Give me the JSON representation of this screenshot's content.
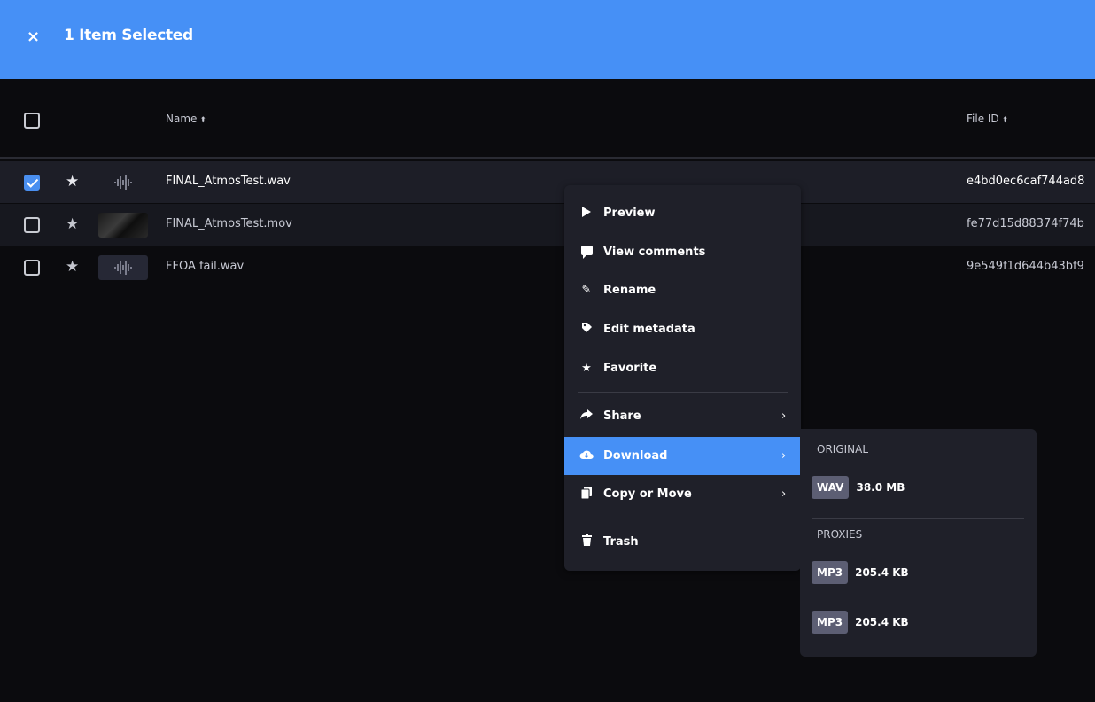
{
  "topbar": {
    "close_glyph": "×",
    "title": "1 Item Selected"
  },
  "table": {
    "columns": {
      "name": "Name",
      "file_id": "File ID"
    },
    "sort_glyph": "⬍",
    "rows": [
      {
        "name": "FINAL_AtmosTest.wav",
        "file_id": "e4bd0ec6caf744ad8",
        "checked": true,
        "thumb": "waveform-icon"
      },
      {
        "name": "FINAL_AtmosTest.mov",
        "file_id": "fe77d15d88374f74b",
        "checked": false,
        "thumb": "video-thumbnail"
      },
      {
        "name": "FFOA fail.wav",
        "file_id": "9e549f1d644b43bf9",
        "checked": false,
        "thumb": "waveform-icon"
      }
    ]
  },
  "context_menu": {
    "items": [
      {
        "label": "Preview",
        "icon": "play-icon"
      },
      {
        "label": "View comments",
        "icon": "comment-icon"
      },
      {
        "label": "Rename",
        "icon": "pen-icon"
      },
      {
        "label": "Edit metadata",
        "icon": "tag-icon"
      },
      {
        "label": "Favorite",
        "icon": "star-icon"
      },
      {
        "label": "Share",
        "icon": "share-icon"
      },
      {
        "label": "Download",
        "icon": "cloud-download-icon"
      },
      {
        "label": "Copy or Move",
        "icon": "copy-icon"
      },
      {
        "label": "Trash",
        "icon": "trash-icon"
      }
    ],
    "chevron": "›"
  },
  "download_submenu": {
    "original_heading": "ORIGINAL",
    "proxies_heading": "PROXIES",
    "original": {
      "format": "WAV",
      "size": "38.0 MB"
    },
    "proxies": [
      {
        "format": "MP3",
        "size": "205.4 KB"
      },
      {
        "format": "MP3",
        "size": "205.4 KB"
      }
    ]
  },
  "colors": {
    "accent": "#4690f6",
    "menu_bg": "#1f2029",
    "page_bg": "#0b0b0e"
  }
}
